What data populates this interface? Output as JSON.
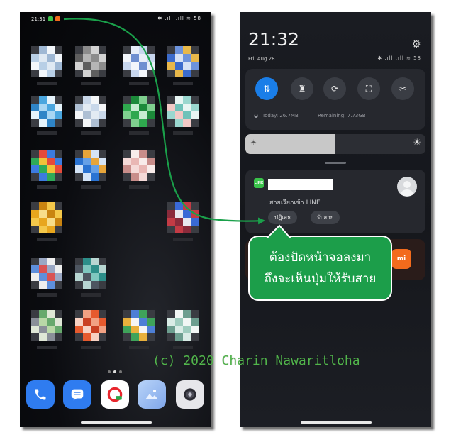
{
  "left_phone": {
    "status_time": "21:31",
    "status_icons": "✱ .ıll .ıll ≋ 58",
    "page_dots": [
      false,
      true,
      false
    ],
    "dock_apps": [
      {
        "name": "phone-app",
        "color": "#2f7cf0"
      },
      {
        "name": "messages-app",
        "color": "#2f7cf0"
      },
      {
        "name": "browser-app",
        "color": "#ffffff"
      },
      {
        "name": "gallery-app",
        "color": "#8fb8f2"
      },
      {
        "name": "camera-app",
        "color": "#e6e6ea"
      }
    ]
  },
  "right_phone": {
    "time": "21:32",
    "date": "Fri, Aug 28",
    "status_icons": "✱ .ıll .ıll ≋ 58",
    "quick_settings": [
      {
        "name": "mobile-data-toggle",
        "glyph": "⇅",
        "active": true
      },
      {
        "name": "flashlight-toggle",
        "glyph": "♜",
        "active": false
      },
      {
        "name": "auto-rotate-toggle",
        "glyph": "⟳",
        "active": false
      },
      {
        "name": "scanner-toggle",
        "glyph": "⛶",
        "active": false
      },
      {
        "name": "screenshot-toggle",
        "glyph": "✂",
        "active": false
      }
    ],
    "data_today": "Today: 26.7MB",
    "data_remaining": "Remaining: 7.73GB",
    "brightness_level": 0.5,
    "notification": {
      "app_icon": "LINE",
      "body": "สายเรียกเข้า LINE",
      "decline_label": "ปฏิเสธ",
      "accept_label": "รับสาย"
    },
    "second_notification_icon": "mi"
  },
  "callout": {
    "line1": "ต้องปัดหน้าจอลงมา",
    "line2": "ถึงจะเห็นปุ่มให้รับสาย"
  },
  "copyright": "(c) 2020 Charin Nawaritloha",
  "colors": {
    "callout_bg": "#1c9e4a",
    "arrow": "#1aa04a",
    "line_green": "#3ac24a",
    "quick_active": "#1a7ee8"
  }
}
